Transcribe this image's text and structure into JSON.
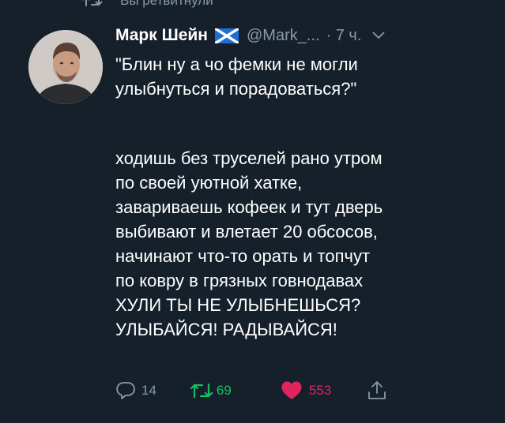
{
  "context": {
    "retweet_label": "Вы ретвитнули",
    "retweet_icon": "retweet-icon"
  },
  "tweet": {
    "author_name": "Марк Шейн",
    "flag_icon": "scotland-flag-icon",
    "handle": "@Mark_...",
    "time": "· 7 ч.",
    "menu_icon": "chevron-down-icon",
    "paragraphs": [
      [
        "\"Блин ну а чо фемки не могли",
        "улыбнуться и порадоваться?\""
      ],
      [
        "ходишь без труселей рано утром",
        "по своей уютной хатке,",
        "завариваешь кофеек и тут дверь",
        "выбивают и влетает 20 обсосов,",
        "начинают что-то орать и топчут",
        "по ковру в грязных говнодавах",
        "ХУЛИ ТЫ НЕ УЛЫБНЕШЬСЯ?",
        "УЛЫБАЙСЯ! РАДЫВАЙСЯ!"
      ]
    ]
  },
  "actions": {
    "replies": "14",
    "retweets": "69",
    "likes": "553",
    "reply_icon": "reply-icon",
    "retweet_icon": "retweet-icon",
    "like_icon": "heart-icon",
    "share_icon": "share-icon"
  },
  "colors": {
    "background": "#15202b",
    "secondary_text": "#8899a6",
    "retweet_green": "#17bf63",
    "like_pink": "#e0245e"
  }
}
